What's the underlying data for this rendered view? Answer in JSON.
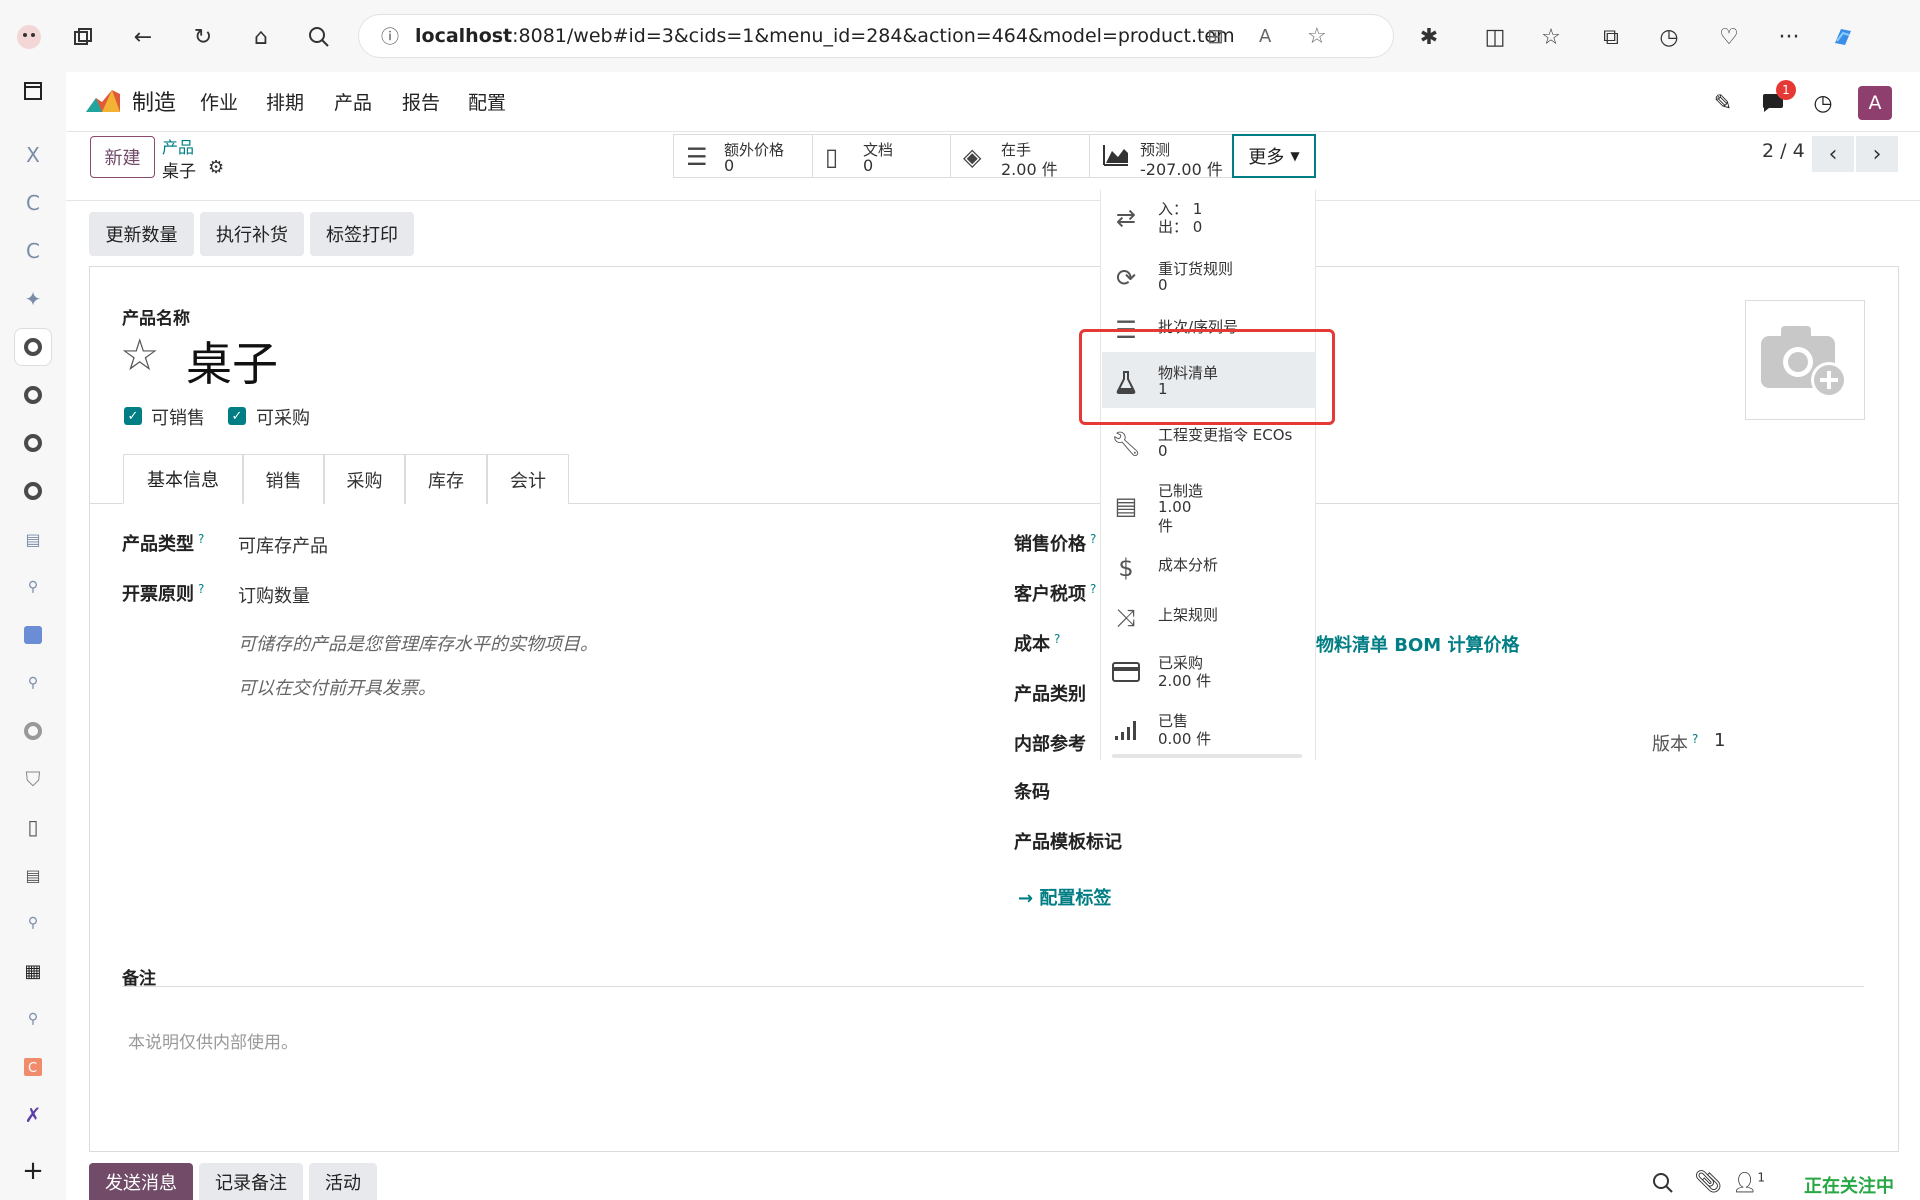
{
  "browser": {
    "url_host": "localhost",
    "url_rest": ":8081/web#id=3&cids=1&menu_id=284&action=464&model=product.template..."
  },
  "nav": {
    "brand": "制造",
    "items": [
      "作业",
      "排期",
      "产品",
      "报告",
      "配置"
    ],
    "chat_badge": "1",
    "avatar": "A"
  },
  "control": {
    "new_label": "新建",
    "breadcrumb_parent": "产品",
    "breadcrumb_current": "桌子",
    "pager": "2 / 4",
    "more_label": "更多"
  },
  "smart_buttons": [
    {
      "label": "额外价格",
      "value": "0",
      "icon": "list-icon"
    },
    {
      "label": "文档",
      "value": "0",
      "icon": "document-icon"
    },
    {
      "label": "在手",
      "value": "2.00 件",
      "icon": "cubes-icon"
    },
    {
      "label": "预测",
      "value": "-207.00 件",
      "icon": "area-chart-icon"
    }
  ],
  "actions": [
    "更新数量",
    "执行补货",
    "标签打印"
  ],
  "dropdown": [
    {
      "label": "入：  1",
      "value": "出：  0",
      "icon": "exchange-icon"
    },
    {
      "label": "重订货规则",
      "value": "0",
      "icon": "refresh-icon"
    },
    {
      "label": "批次/序列号",
      "value": "",
      "icon": "bars-icon"
    },
    {
      "label": "物料清单",
      "value": "1",
      "icon": "flask-icon"
    },
    {
      "label": "工程变更指令 ECOs",
      "value": "0",
      "icon": "wrench-icon"
    },
    {
      "label": "已制造",
      "value": "1.00",
      "value2": "件",
      "icon": "manufacture-list-icon"
    },
    {
      "label": "成本分析",
      "value": "",
      "icon": "dollar-icon"
    },
    {
      "label": "上架规则",
      "value": "",
      "icon": "random-icon"
    },
    {
      "label": "已采购",
      "value": "2.00 件",
      "icon": "credit-card-icon"
    },
    {
      "label": "已售",
      "value": "0.00 件",
      "icon": "signal-icon"
    }
  ],
  "form": {
    "name_label": "产品名称",
    "name": "桌子",
    "can_sell": "可销售",
    "can_purchase": "可采购",
    "tabs": [
      "基本信息",
      "销售",
      "采购",
      "库存",
      "会计"
    ],
    "product_type_label": "产品类型",
    "product_type": "可库存产品",
    "invoice_policy_label": "开票原则",
    "invoice_policy": "订购数量",
    "note1": "可储存的产品是您管理库存水平的实物项目。",
    "note2": "可以在交付前开具发票。",
    "sale_price_label": "销售价格",
    "customer_tax_label": "客户税项",
    "cost_label": "成本",
    "bom_price_link": "从物料清单 BOM 计算价格",
    "category_label": "产品类别",
    "internal_ref_label": "内部参考",
    "barcode_label": "条码",
    "tags_label": "产品模板标记",
    "configure_tags": "配置标签",
    "version_label": "版本",
    "version": "1",
    "notes_label": "备注",
    "notes_placeholder": "本说明仅供内部使用。"
  },
  "chatter": {
    "send_message": "发送消息",
    "log_note": "记录备注",
    "activity": "活动",
    "followers_count": "1",
    "following": "正在关注中"
  },
  "colors": {
    "brand": "#714b67",
    "teal": "#017e84",
    "highlight": "#e53935"
  }
}
